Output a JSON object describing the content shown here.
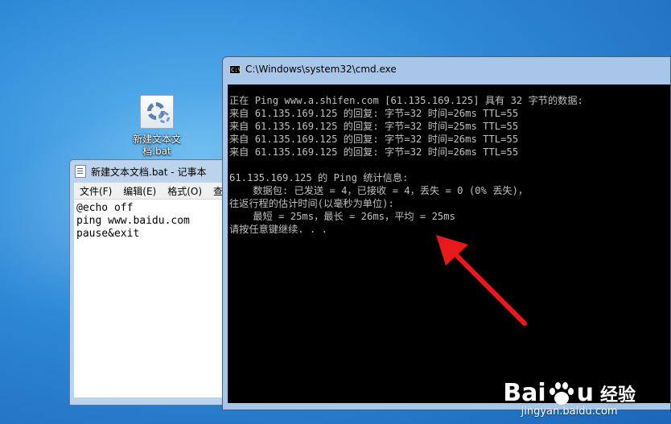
{
  "desktop": {
    "icon": {
      "line1": "新建文本文",
      "line2": "档.bat",
      "icon_name": "batch-file-icon"
    }
  },
  "notepad": {
    "title": "新建文本文档.bat - 记事本",
    "menu": [
      "文件(F)",
      "编辑(E)",
      "格式(O)",
      "查"
    ],
    "lines": [
      "@echo off",
      "ping www.baidu.com",
      "pause&exit"
    ]
  },
  "cmd": {
    "title": "C:\\Windows\\system32\\cmd.exe",
    "icon_text": "C:\\",
    "lines": [
      "正在 Ping www.a.shifen.com [61.135.169.125] 具有 32 字节的数据:",
      "来自 61.135.169.125 的回复: 字节=32 时间=26ms TTL=55",
      "来自 61.135.169.125 的回复: 字节=32 时间=25ms TTL=55",
      "来自 61.135.169.125 的回复: 字节=32 时间=26ms TTL=55",
      "来自 61.135.169.125 的回复: 字节=32 时间=26ms TTL=55",
      "",
      "61.135.169.125 的 Ping 统计信息:",
      "    数据包: 已发送 = 4，已接收 = 4，丢失 = 0 (0% 丢失)，",
      "往返行程的估计时间(以毫秒为单位):",
      "    最短 = 25ms，最长 = 26ms，平均 = 25ms",
      "请按任意键继续. . ."
    ]
  },
  "annotation": {
    "arrow_color": "#e8191a"
  },
  "watermark": {
    "brand_left": "Bai",
    "brand_right": "u",
    "brand_cn": "经验",
    "url": "jingyan.baidu.com"
  }
}
